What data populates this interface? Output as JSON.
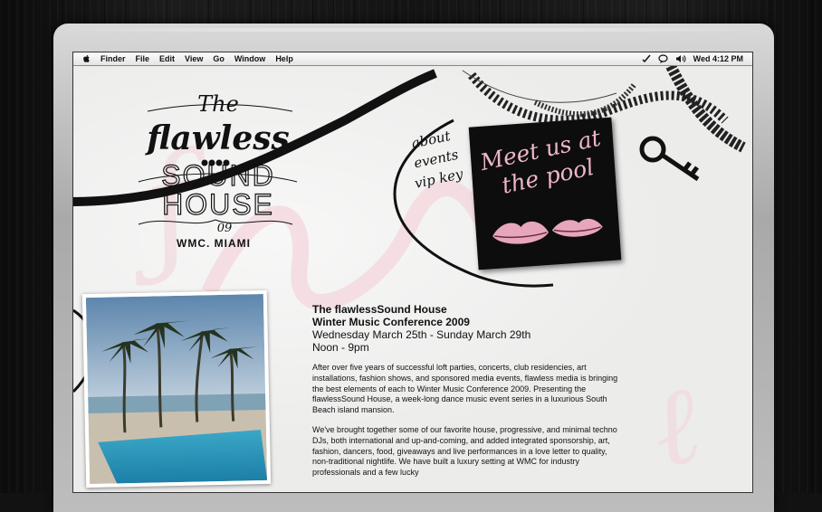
{
  "menubar": {
    "items": [
      "Finder",
      "File",
      "Edit",
      "View",
      "Go",
      "Window",
      "Help"
    ],
    "clock": "Wed 4:12 PM"
  },
  "logo": {
    "the": "The",
    "flawless": "flawless",
    "sound": "SOUND",
    "house": "HOUSE",
    "year": "09",
    "location": "WMC, MIAMI"
  },
  "nav": {
    "items": [
      "about",
      "events",
      "vip key"
    ]
  },
  "promo": {
    "line1": "Meet us at",
    "line2": "the pool"
  },
  "event": {
    "title_line1": "The flawlessSound House",
    "title_line2": "Winter Music Conference 2009",
    "dates": "Wednesday March 25th - Sunday March 29th",
    "time": "Noon - 9pm",
    "paragraph1": "After over five years of successful loft parties, concerts, club residencies, art installations, fashion shows, and sponsored media events, flawless media is bringing the best elements of each to Winter Music Conference 2009. Presenting the flawlessSound House, a week-long dance music event series in a luxurious South Beach island mansion.",
    "paragraph2": "We've brought together some of our favorite house, progressive, and minimal techno DJs, both international and up-and-coming, and added integrated sponsorship, art, fashion, dancers, food, giveaways and live performances in a love letter to quality, non-traditional nightlife. We have built a luxury setting at WMC for industry professionals and a few lucky"
  },
  "colors": {
    "accent_pink": "#f1b6c8",
    "ink": "#111111",
    "paper": "#ececeb"
  }
}
